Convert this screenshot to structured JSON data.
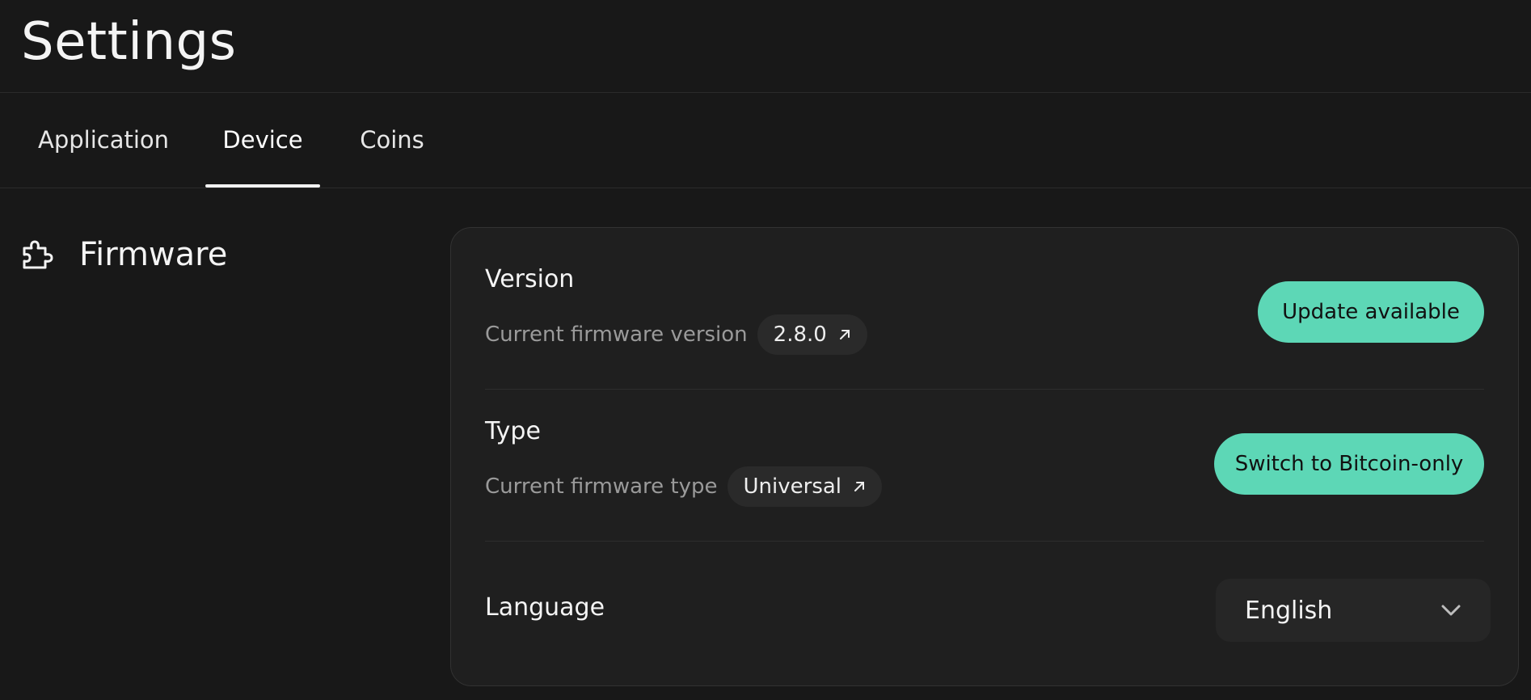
{
  "header": {
    "title": "Settings"
  },
  "tabs": [
    {
      "label": "Application",
      "active": false
    },
    {
      "label": "Device",
      "active": true
    },
    {
      "label": "Coins",
      "active": false
    }
  ],
  "section": {
    "title": "Firmware",
    "icon": "puzzle-icon"
  },
  "firmware": {
    "version": {
      "title": "Version",
      "subtitle": "Current firmware version",
      "value": "2.8.0",
      "button": "Update available"
    },
    "type": {
      "title": "Type",
      "subtitle": "Current firmware type",
      "value": "Universal",
      "button": "Switch to Bitcoin-only"
    },
    "language": {
      "title": "Language",
      "selected": "English"
    }
  },
  "colors": {
    "background": "#181818",
    "card": "#1f1f1f",
    "accent": "#5dd7b6",
    "muted_text": "#9a9a9a"
  }
}
